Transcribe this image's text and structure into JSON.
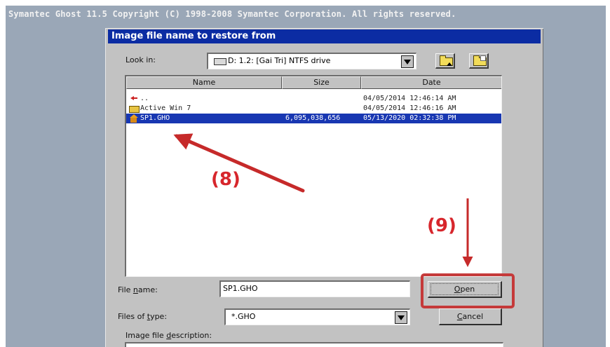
{
  "app": {
    "title": "Symantec Ghost 11.5   Copyright (C) 1998-2008 Symantec Corporation. All rights reserved."
  },
  "dialog": {
    "title": "Image file name to restore from",
    "look_in": {
      "label": "Look in:",
      "value": "D: 1.2: [Gai Tri] NTFS drive"
    },
    "toolbar": {
      "up_icon": "up-folder-icon",
      "new_icon": "new-folder-icon"
    },
    "columns": [
      "Name",
      "Size",
      "Date"
    ],
    "files": [
      {
        "name": "..",
        "size": "",
        "date": "04/05/2014 12:46:14 AM",
        "icon": "back-arrow-icon",
        "selected": false
      },
      {
        "name": "Active Win 7",
        "size": "",
        "date": "04/05/2014 12:46:16 AM",
        "icon": "folder-icon",
        "selected": false
      },
      {
        "name": "SP1.GHO",
        "size": "6,095,038,656",
        "date": "05/13/2020 02:32:38 PM",
        "icon": "ghost-image-icon",
        "selected": true
      }
    ],
    "file_name": {
      "label": "File name:",
      "value": "SP1.GHO"
    },
    "files_of_type": {
      "label": "Files of type:",
      "value": "*.GHO"
    },
    "image_description": {
      "label": "Image file description:"
    },
    "buttons": {
      "open": "Open",
      "cancel": "Cancel"
    }
  },
  "annotations": {
    "step8": "(8)",
    "step9": "(9)",
    "color": "#d7262c"
  },
  "colors": {
    "title_bar": "#0b2ca3",
    "selection": "#1837b2",
    "dialog_bg": "#c2c2c2",
    "desktop_bg": "#9aa7b7"
  }
}
